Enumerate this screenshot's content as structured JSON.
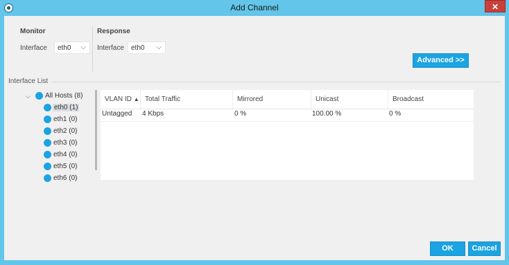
{
  "window": {
    "title": "Add Channel",
    "close_label": "✕"
  },
  "monitor": {
    "title": "Monitor",
    "interface_label": "Interface",
    "interface_value": "eth0"
  },
  "response": {
    "title": "Response",
    "interface_label": "Interface",
    "interface_value": "eth0"
  },
  "advanced_label": "Advanced >>",
  "interface_list": {
    "label": "Interface List",
    "root": "All Hosts (8)",
    "items": [
      "eth0 (1)",
      "eth1 (0)",
      "eth2 (0)",
      "eth3 (0)",
      "eth4 (0)",
      "eth5 (0)",
      "eth6 (0)"
    ],
    "selected_index": 0
  },
  "table": {
    "columns": [
      "VLAN ID",
      "Total Traffic",
      "Mirrored",
      "Unicast",
      "Broadcast"
    ],
    "sort_indicator": "▲",
    "rows": [
      [
        "Untagged",
        "4 Kbps",
        "0 %",
        "100.00 %",
        "0 %"
      ]
    ]
  },
  "footer": {
    "ok_label": "OK",
    "cancel_label": "Cancel"
  }
}
